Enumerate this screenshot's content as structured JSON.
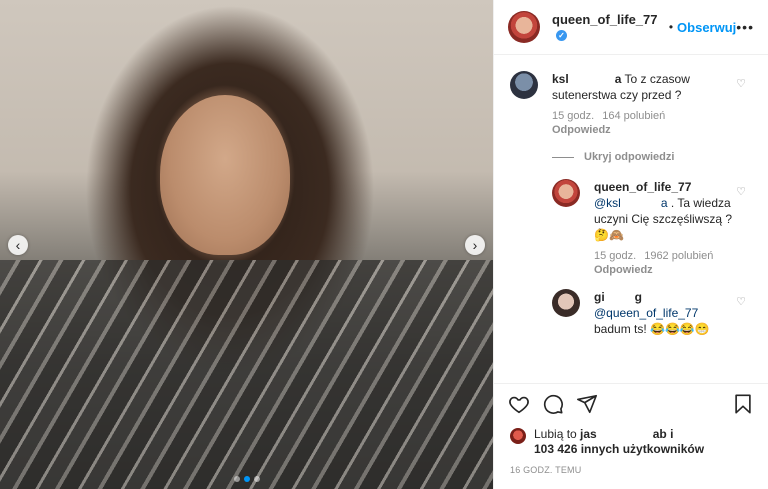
{
  "header": {
    "username": "queen_of_life_77",
    "separator": "•",
    "follow_label": "Obserwuj",
    "more_icon": "more-horizontal-icon"
  },
  "comments": [
    {
      "user": "ksl",
      "user_suffix": "a",
      "text": "To z czasow sutenerstwa czy przed ?",
      "time": "15 godz.",
      "likes": "164 polubień",
      "reply_label": "Odpowiedz"
    }
  ],
  "hide_replies_label": "Ukryj odpowiedzi",
  "replies": [
    {
      "user": "queen_of_life_77",
      "mention": "@ksl",
      "mention_suffix": "a",
      "text": ". Ta wiedza uczyni Cię szczęśliwszą ?🤔🙈",
      "time": "15 godz.",
      "likes": "1962 polubień",
      "reply_label": "Odpowiedz"
    },
    {
      "user": "gi",
      "user_suffix": "g",
      "mention": "@queen_of_life_77",
      "text": "badum ts! 😂😂😂😁"
    }
  ],
  "likes": {
    "prefix": "Lubią to",
    "user_start": "jas",
    "user_end": "ab i",
    "others": "103 426 innych użytkowników"
  },
  "timestamp": "16 GODZ. TEMU",
  "nav": {
    "prev": "‹",
    "next": "›"
  }
}
